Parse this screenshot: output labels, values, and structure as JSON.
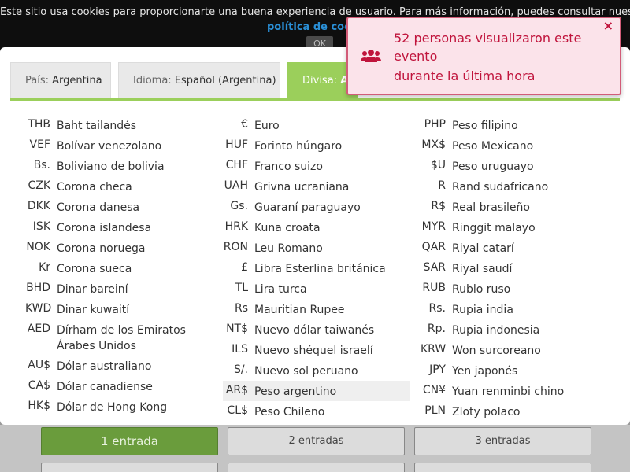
{
  "cookie": {
    "text": "Este sitio usa cookies para proporcionarte una buena experiencia de usuario. Para más información, puedes consultar nuestra",
    "link": "política de cook",
    "ok": "OK"
  },
  "tabs": [
    {
      "label": "País:",
      "value": "Argentina"
    },
    {
      "label": "Idioma:",
      "value": "Español (Argentina)"
    },
    {
      "label": "Divisa:",
      "value": "AR"
    }
  ],
  "currencies": {
    "col1": [
      {
        "symbol": "THB",
        "name": "Baht tailandés"
      },
      {
        "symbol": "VEF",
        "name": "Bolívar venezolano"
      },
      {
        "symbol": "Bs.",
        "name": "Boliviano de bolivia"
      },
      {
        "symbol": "CZK",
        "name": "Corona checa"
      },
      {
        "symbol": "DKK",
        "name": "Corona danesa"
      },
      {
        "symbol": "ISK",
        "name": "Corona islandesa"
      },
      {
        "symbol": "NOK",
        "name": "Corona noruega"
      },
      {
        "symbol": "Kr",
        "name": "Corona sueca"
      },
      {
        "symbol": "BHD",
        "name": "Dinar bareiní"
      },
      {
        "symbol": "KWD",
        "name": "Dinar kuwaití"
      },
      {
        "symbol": "AED",
        "name": "Dírham de los Emiratos Árabes Unidos"
      },
      {
        "symbol": "AU$",
        "name": "Dólar australiano"
      },
      {
        "symbol": "CA$",
        "name": "Dólar canadiense"
      },
      {
        "symbol": "HK$",
        "name": "Dólar de Hong Kong"
      }
    ],
    "col2": [
      {
        "symbol": "€",
        "name": "Euro"
      },
      {
        "symbol": "HUF",
        "name": "Forinto húngaro"
      },
      {
        "symbol": "CHF",
        "name": "Franco suizo"
      },
      {
        "symbol": "UAH",
        "name": "Grivna ucraniana"
      },
      {
        "symbol": "Gs.",
        "name": "Guaraní paraguayo"
      },
      {
        "symbol": "HRK",
        "name": "Kuna croata"
      },
      {
        "symbol": "RON",
        "name": "Leu Romano"
      },
      {
        "symbol": "£",
        "name": "Libra Esterlina británica"
      },
      {
        "symbol": "TL",
        "name": "Lira turca"
      },
      {
        "symbol": "Rs",
        "name": "Mauritian Rupee"
      },
      {
        "symbol": "NT$",
        "name": "Nuevo dólar taiwanés"
      },
      {
        "symbol": "ILS",
        "name": "Nuevo shéquel israelí"
      },
      {
        "symbol": "S/.",
        "name": "Nuevo sol peruano"
      },
      {
        "symbol": "AR$",
        "name": "Peso argentino",
        "selected": true
      },
      {
        "symbol": "CL$",
        "name": "Peso Chileno"
      }
    ],
    "col3": [
      {
        "symbol": "PHP",
        "name": "Peso filipino"
      },
      {
        "symbol": "MX$",
        "name": "Peso Mexicano"
      },
      {
        "symbol": "$U",
        "name": "Peso uruguayo"
      },
      {
        "symbol": "R",
        "name": "Rand sudafricano"
      },
      {
        "symbol": "R$",
        "name": "Real brasileño"
      },
      {
        "symbol": "MYR",
        "name": "Ringgit malayo"
      },
      {
        "symbol": "QAR",
        "name": "Riyal catarí"
      },
      {
        "symbol": "SAR",
        "name": "Riyal saudí"
      },
      {
        "symbol": "RUB",
        "name": "Rublo ruso"
      },
      {
        "symbol": "Rs.",
        "name": "Rupia india"
      },
      {
        "symbol": "Rp.",
        "name": "Rupia indonesia"
      },
      {
        "symbol": "KRW",
        "name": "Won surcoreano"
      },
      {
        "symbol": "JPY",
        "name": "Yen japonés"
      },
      {
        "symbol": "CN¥",
        "name": "Yuan renminbi chino"
      },
      {
        "symbol": "PLN",
        "name": "Zloty polaco"
      }
    ]
  },
  "toast": {
    "title": "52 personas visualizaron este evento",
    "subtitle": "durante la última hora",
    "close": "×",
    "icon": "users-icon"
  },
  "tickets": [
    "1 entrada",
    "2 entradas",
    "3 entradas"
  ],
  "colors": {
    "accent": "#9bcf5b",
    "alert": "#c0143c",
    "alert_bg": "#fbe3ea"
  }
}
